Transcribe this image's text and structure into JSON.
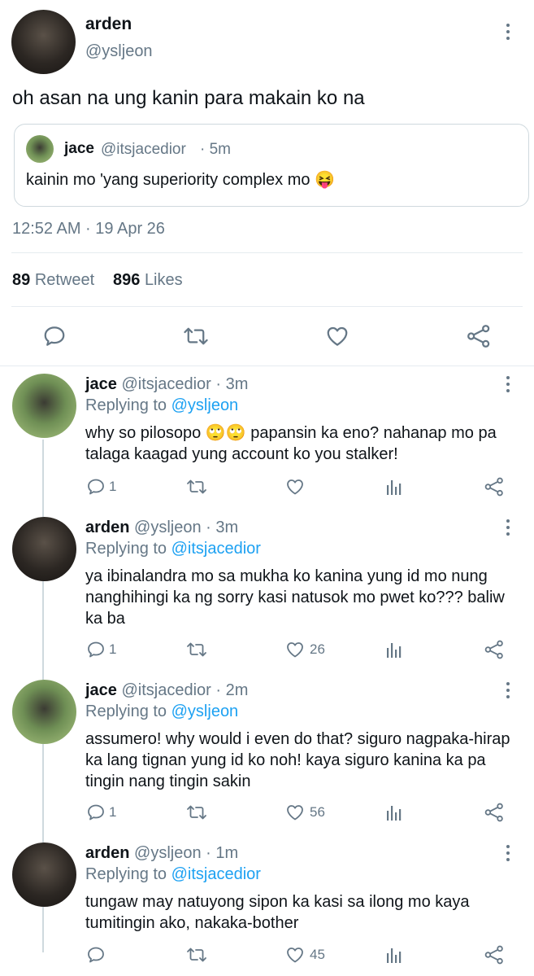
{
  "main_tweet": {
    "name": "arden",
    "handle": "@ysljeon",
    "text": "oh asan na ung kanin para makain ko na",
    "quote": {
      "name": "jace",
      "handle": "@itsjacedior",
      "time": "· 5m",
      "text": "kainin mo 'yang superiority complex mo 😝"
    },
    "timestamp": "12:52 AM · 19 Apr 26",
    "retweet_count": "89",
    "retweet_label": "Retweet",
    "likes_count": "896",
    "likes_label": "Likes"
  },
  "replies": [
    {
      "name": "jace",
      "meta": "@itsjacedior · 3m",
      "replying_label": "Replying to",
      "replying_to": "@ysljeon",
      "text": "why so pilosopo 🙄🙄 papansin ka eno? nahanap mo pa talaga kaagad yung account ko you stalker!",
      "reply_count": "1",
      "like_count": ""
    },
    {
      "name": "arden",
      "meta": "@ysljeon · 3m",
      "replying_label": "Replying to",
      "replying_to": "@itsjacedior",
      "text": "ya ibinalandra mo sa mukha ko kanina yung id mo nung nanghihingi ka ng sorry kasi natusok mo pwet ko??? baliw ka ba",
      "reply_count": "1",
      "like_count": "26"
    },
    {
      "name": "jace",
      "meta": "@itsjacedior · 2m",
      "replying_label": "Replying to",
      "replying_to": "@ysljeon",
      "text": "assumero! why would i even do that? siguro nagpaka-hirap ka lang tignan yung id ko noh! kaya siguro kanina ka pa tingin nang tingin sakin",
      "reply_count": "1",
      "like_count": "56"
    },
    {
      "name": "arden",
      "meta": "@ysljeon · 1m",
      "replying_label": "Replying to",
      "replying_to": "@itsjacedior",
      "text": "tungaw may natuyong sipon ka kasi sa ilong mo kaya tumitingin ako, nakaka-bother",
      "reply_count": "",
      "like_count": "45"
    }
  ]
}
